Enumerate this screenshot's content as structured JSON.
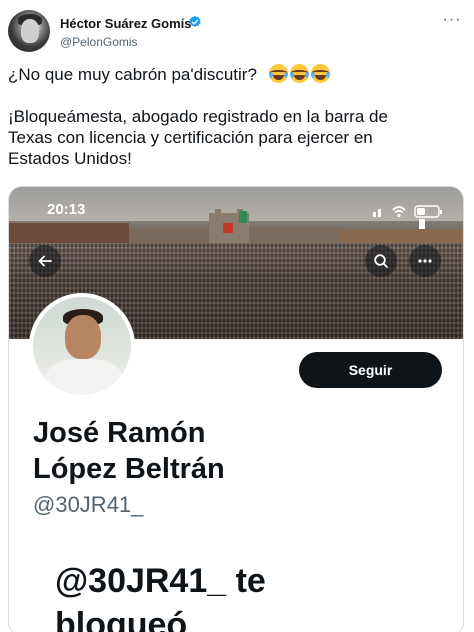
{
  "tweet": {
    "author_name": "Héctor Suárez Gomís",
    "author_handle": "@PelonGomis",
    "text_line1": "¿No que muy cabrón pa'discutir?",
    "text_line2": "¡Bloqueámesta, abogado registrado en la barra de",
    "text_line3": "Texas con licencia y certificación para ejercer en",
    "text_line4": "Estados Unidos!",
    "emoji": [
      "face-with-tears-of-joy",
      "face-with-tears-of-joy",
      "face-with-tears-of-joy"
    ]
  },
  "screenshot": {
    "status_time": "20:13",
    "follow_label": "Seguir",
    "display_name_line1": "José Ramón",
    "display_name_line2": "López Beltrán",
    "profile_handle": "@30JR41_",
    "blocked_line1": "@30JR41_ te",
    "blocked_line2": "bloqueó"
  },
  "icons": {
    "verified": "verified-badge-icon",
    "more": "more-horizontal-icon",
    "back": "back-arrow-icon",
    "search": "search-icon",
    "overflow": "overflow-menu-icon"
  },
  "colors": {
    "text": "#0f1419",
    "secondary_text": "#536471",
    "verified_blue": "#1d9bf0",
    "follow_button": "#0f1419"
  }
}
